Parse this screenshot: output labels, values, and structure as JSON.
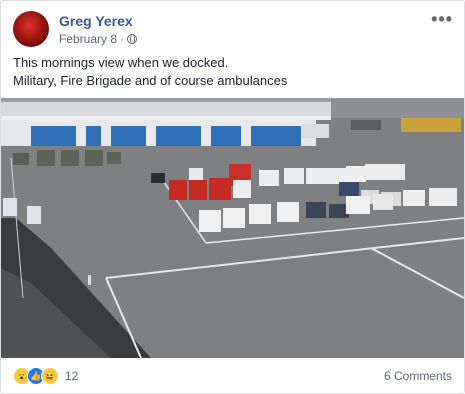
{
  "post": {
    "author": "Greg Yerex",
    "date": "February 8",
    "date_separator": "·",
    "more_label": "•••",
    "text_line1": "This mornings view when we docked.",
    "text_line2": "Military, Fire Brigade and of course ambulances"
  },
  "photo": {
    "description_icon": "photo-icon"
  },
  "footer": {
    "reactions": [
      "wow-icon",
      "like-icon",
      "haha-icon"
    ],
    "reaction_count": "12",
    "comments": "6 Comments"
  },
  "colors": {
    "author": "#385898",
    "meta": "#616770",
    "like": "#2078f4",
    "emoji": "#f7c948"
  }
}
